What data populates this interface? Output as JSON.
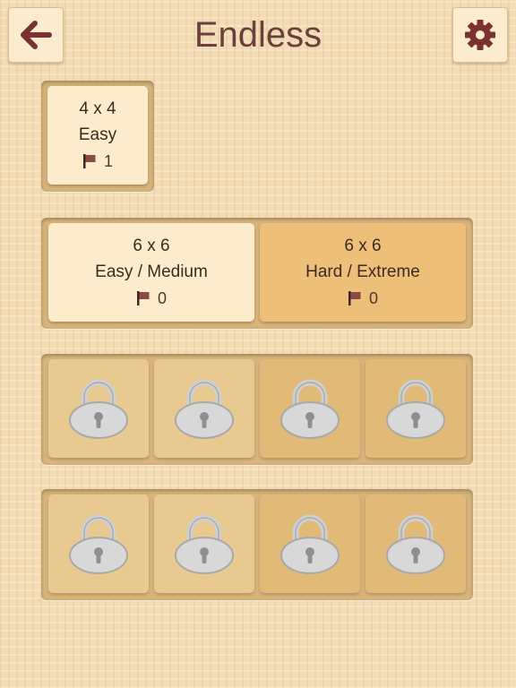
{
  "header": {
    "title": "Endless",
    "back_icon": "arrow-left-icon",
    "settings_icon": "gear-icon"
  },
  "levels": {
    "row1": [
      {
        "size": "4 x 4",
        "difficulty": "Easy",
        "flags": "1"
      }
    ],
    "row2": [
      {
        "size": "6 x 6",
        "difficulty": "Easy / Medium",
        "flags": "0"
      },
      {
        "size": "6 x 6",
        "difficulty": "Hard / Extreme",
        "flags": "0"
      }
    ],
    "row3_locked": 4,
    "row4_locked": 4
  },
  "colors": {
    "title": "#6b3f3a",
    "accent": "#7a3131",
    "lock": "#cfcfcf"
  }
}
